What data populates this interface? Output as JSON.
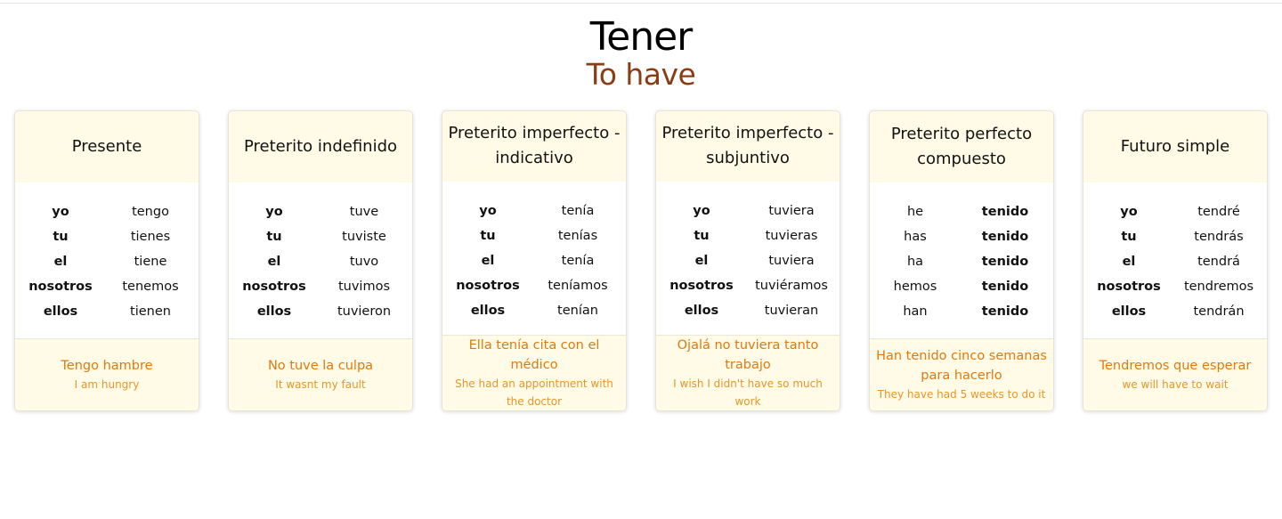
{
  "page": {
    "title": "Tener",
    "subtitle": "To have",
    "colors": {
      "title": "#000000",
      "subtitle": "#8a3d14",
      "example": "#e07a10",
      "card_header_bg": "#fffbe6"
    }
  },
  "cards": [
    {
      "tense": "Presente",
      "rows": [
        {
          "pronoun": "yo",
          "verb": "tengo"
        },
        {
          "pronoun": "tu",
          "verb": "tienes"
        },
        {
          "pronoun": "el",
          "verb": "tiene"
        },
        {
          "pronoun": "nosotros",
          "verb": "tenemos"
        },
        {
          "pronoun": "ellos",
          "verb": "tienen"
        }
      ],
      "example": "Tengo hambre",
      "translation": "I am hungry"
    },
    {
      "tense": "Preterito indefinido",
      "rows": [
        {
          "pronoun": "yo",
          "verb": "tuve"
        },
        {
          "pronoun": "tu",
          "verb": "tuviste"
        },
        {
          "pronoun": "el",
          "verb": "tuvo"
        },
        {
          "pronoun": "nosotros",
          "verb": "tuvimos"
        },
        {
          "pronoun": "ellos",
          "verb": "tuvieron"
        }
      ],
      "example": "No tuve la culpa",
      "translation": "It wasnt my fault"
    },
    {
      "tense": "Preterito imperfecto - indicativo",
      "rows": [
        {
          "pronoun": "yo",
          "verb": "tenía"
        },
        {
          "pronoun": "tu",
          "verb": "tenías"
        },
        {
          "pronoun": "el",
          "verb": "tenía"
        },
        {
          "pronoun": "nosotros",
          "verb": "teníamos"
        },
        {
          "pronoun": "ellos",
          "verb": "tenían"
        }
      ],
      "example": "Ella tenía cita con el médico",
      "translation": "She had an appointment with the doctor"
    },
    {
      "tense": "Preterito imperfecto - subjuntivo",
      "rows": [
        {
          "pronoun": "yo",
          "verb": "tuviera"
        },
        {
          "pronoun": "tu",
          "verb": "tuvieras"
        },
        {
          "pronoun": "el",
          "verb": "tuviera"
        },
        {
          "pronoun": "nosotros",
          "verb": "tuviéramos"
        },
        {
          "pronoun": "ellos",
          "verb": "tuvieran"
        }
      ],
      "example": "Ojalá no tuviera tanto trabajo",
      "translation": "I wish I didn't have so much work"
    },
    {
      "tense": "Preterito perfecto compuesto",
      "rows": [
        {
          "pronoun": "he",
          "verb": "tenido"
        },
        {
          "pronoun": "has",
          "verb": "tenido"
        },
        {
          "pronoun": "ha",
          "verb": "tenido"
        },
        {
          "pronoun": "hemos",
          "verb": "tenido"
        },
        {
          "pronoun": "han",
          "verb": "tenido"
        }
      ],
      "example": "Han tenido cinco semanas para hacerlo",
      "translation": "They have had 5 weeks to do it"
    },
    {
      "tense": "Futuro simple",
      "rows": [
        {
          "pronoun": "yo",
          "verb": "tendré"
        },
        {
          "pronoun": "tu",
          "verb": "tendrás"
        },
        {
          "pronoun": "el",
          "verb": "tendrá"
        },
        {
          "pronoun": "nosotros",
          "verb": "tendremos"
        },
        {
          "pronoun": "ellos",
          "verb": "tendrán"
        }
      ],
      "example": "Tendremos que esperar",
      "translation": "we will have to wait"
    }
  ]
}
